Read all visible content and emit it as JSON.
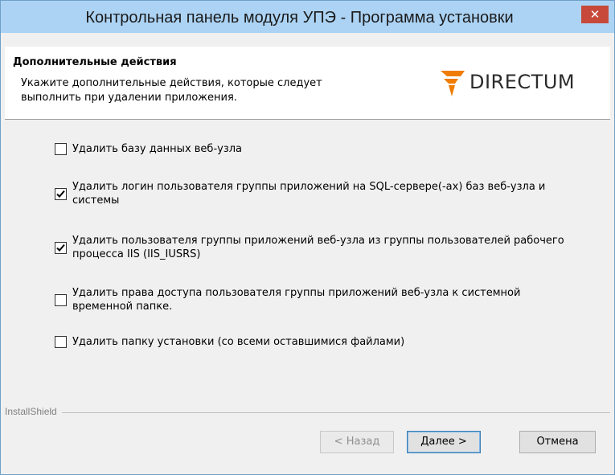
{
  "window": {
    "title": "Контрольная панель модуля УПЭ - Программа установки",
    "close_glyph": "✕"
  },
  "header": {
    "title": "Дополнительные действия",
    "description": "Укажите дополнительные действия, которые следует выполнить при удалении приложения.",
    "logo_text": "DIRECTUM",
    "logo_color": "#f07c00"
  },
  "options": [
    {
      "label": "Удалить базу данных веб-узла",
      "checked": false
    },
    {
      "label": "Удалить логин пользователя группы приложений на SQL-сервере(-ах) баз веб-узла и системы",
      "checked": true
    },
    {
      "label": "Удалить пользователя группы приложений веб-узла из группы пользователей рабочего процесса IIS (IIS_IUSRS)",
      "checked": true
    },
    {
      "label": "Удалить права доступа пользователя группы приложений веб-узла к системной временной папке.",
      "checked": false
    },
    {
      "label": "Удалить папку установки (со всеми оставшимися файлами)",
      "checked": false
    }
  ],
  "footer": {
    "brand": "InstallShield",
    "back_label": "< Назад",
    "next_label": "Далее >",
    "cancel_label": "Отмена"
  }
}
